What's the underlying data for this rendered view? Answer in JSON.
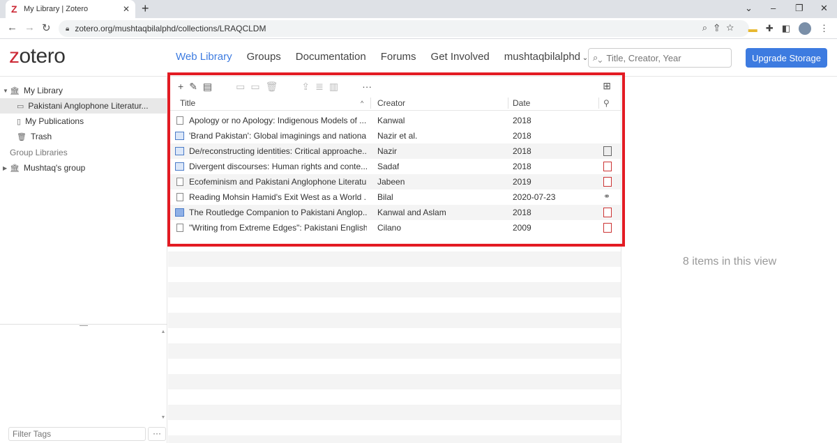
{
  "browser": {
    "tab_title": "My Library | Zotero",
    "tab_favicon": "Z",
    "tab_close": "✕",
    "new_tab": "+",
    "url": "zotero.org/mushtaqbilalphd/collections/LRAQCLDM",
    "win_min": "–",
    "win_max": "❐",
    "win_close": "✕",
    "chev": "⌄"
  },
  "header": {
    "logo_z": "z",
    "logo_rest": "otero",
    "nav": [
      "Web Library",
      "Groups",
      "Documentation",
      "Forums",
      "Get Involved",
      "mushtaqbilalphd"
    ],
    "search_placeholder": "Title, Creator, Year",
    "upgrade_label": "Upgrade Storage"
  },
  "sidebar": {
    "my_library": "My Library",
    "collection": "Pakistani Anglophone Literatur...",
    "my_publications": "My Publications",
    "trash": "Trash",
    "group_libraries": "Group Libraries",
    "group": "Mushtaq's group",
    "filter_tags_placeholder": "Filter Tags",
    "more": "···"
  },
  "items": {
    "columns": {
      "title": "Title",
      "creator": "Creator",
      "date": "Date"
    },
    "rows": [
      {
        "title": "Apology or no Apology: Indigenous Models of ...",
        "creator": "Kanwal",
        "date": "2018",
        "type": "document",
        "attachment": ""
      },
      {
        "title": "'Brand Pakistan': Global imaginings and nationa...",
        "creator": "Nazir et al.",
        "date": "2018",
        "type": "book-section",
        "attachment": ""
      },
      {
        "title": "De/reconstructing identities: Critical approache...",
        "creator": "Nazir",
        "date": "2018",
        "type": "book-section",
        "attachment": "snapshot"
      },
      {
        "title": "Divergent discourses: Human rights and conte...",
        "creator": "Sadaf",
        "date": "2018",
        "type": "book-section",
        "attachment": "pdf"
      },
      {
        "title": "Ecofeminism and Pakistani Anglophone Literature",
        "creator": "Jabeen",
        "date": "2019",
        "type": "document",
        "attachment": "pdf"
      },
      {
        "title": "Reading Mohsin Hamid's Exit West as a World ...",
        "creator": "Bilal",
        "date": "2020-07-23",
        "type": "document",
        "attachment": "link"
      },
      {
        "title": "The Routledge Companion to Pakistani Anglop...",
        "creator": "Kanwal and Aslam",
        "date": "2018",
        "type": "book",
        "attachment": "pdf"
      },
      {
        "title": "\"Writing from Extreme Edges\": Pakistani English...",
        "creator": "Cilano",
        "date": "2009",
        "type": "document",
        "attachment": "pdf"
      }
    ]
  },
  "right": {
    "count_message": "8 items in this view"
  },
  "colors": {
    "accent": "#3d7be0",
    "brand_red": "#cc2936",
    "highlight_box": "#e31b23"
  }
}
